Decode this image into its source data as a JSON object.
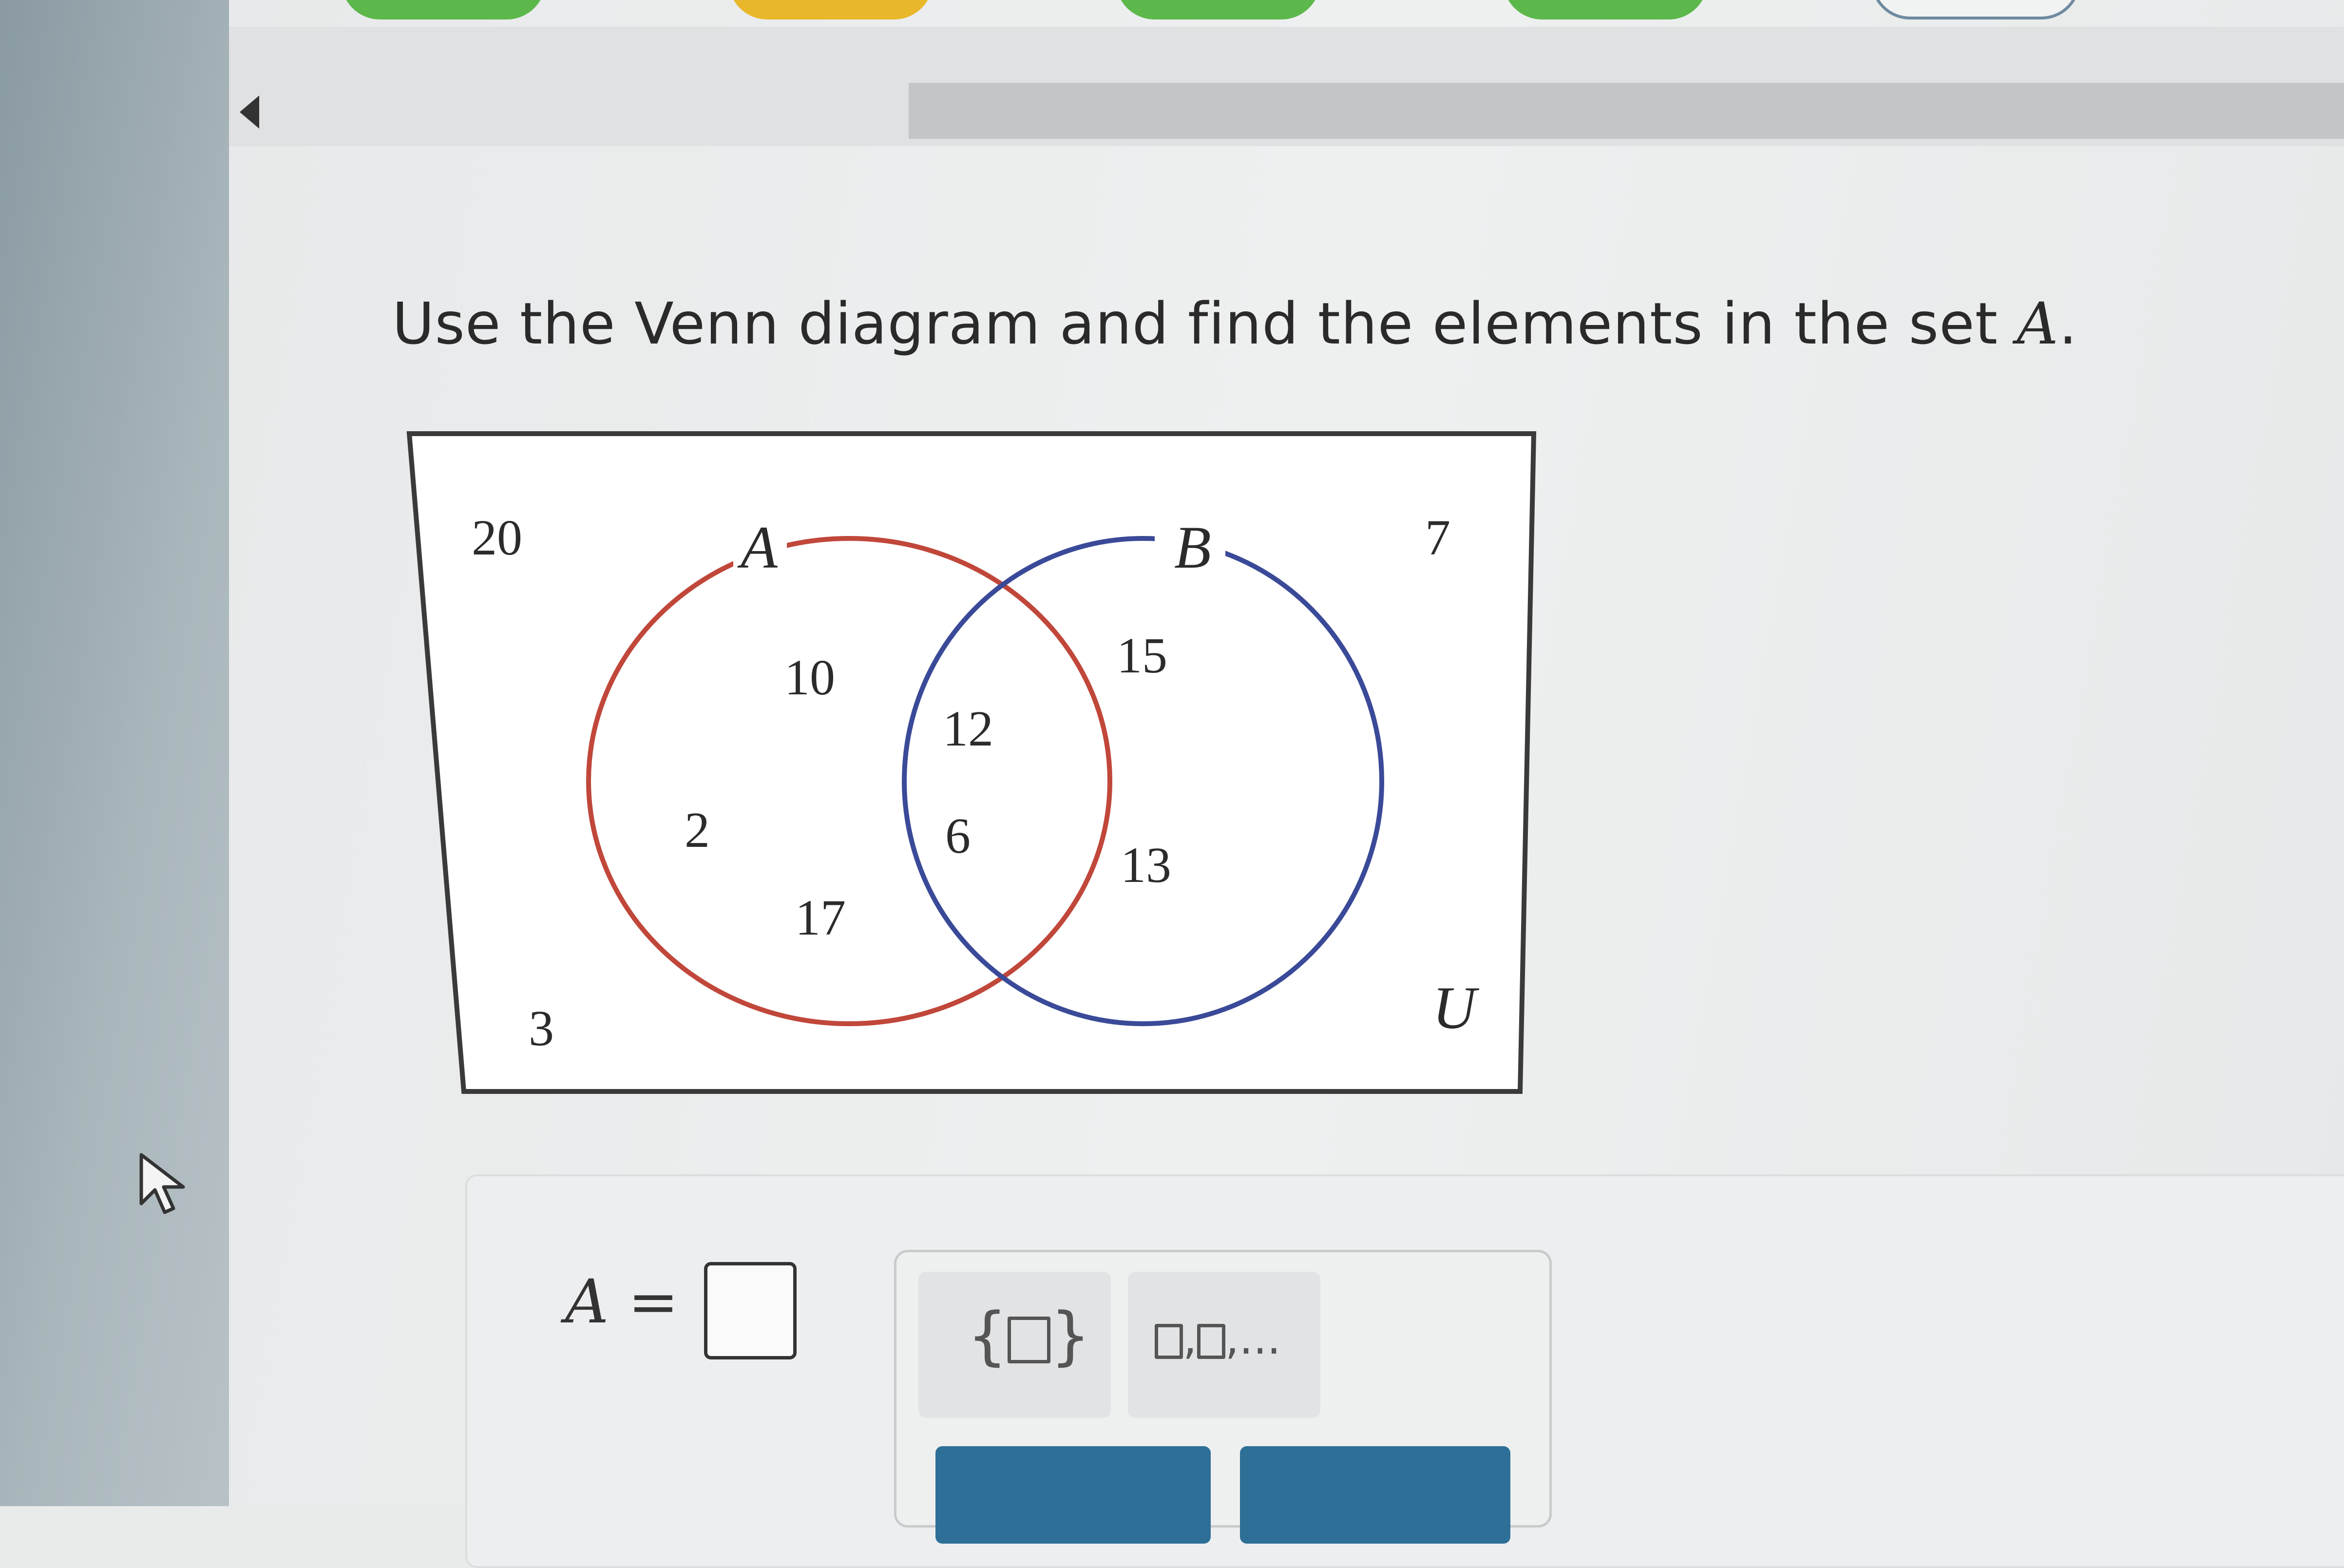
{
  "header": {
    "progress_tabs": [
      {
        "color": "#5cb84a"
      },
      {
        "color": "#e8b72a"
      },
      {
        "color": "#5cb84a"
      },
      {
        "color": "#5cb84a"
      },
      {
        "color": "#f1f2f2"
      }
    ]
  },
  "question": {
    "text": "Use the Venn diagram and find the elements in the set ",
    "variable": "A",
    "end": "."
  },
  "venn": {
    "set_a_label": "A",
    "set_b_label": "B",
    "universe_label": "U",
    "a_color": "#c0473a",
    "b_color": "#3a4a98",
    "outside": [
      "20",
      "7",
      "3"
    ],
    "a_only": [
      "10",
      "2",
      "17"
    ],
    "intersection": [
      "12",
      "6"
    ],
    "b_only": [
      "15",
      "13"
    ]
  },
  "answer": {
    "variable": "A",
    "equals": "="
  },
  "palette": {
    "set_braces_icon": "set-braces-icon",
    "list_icon": "list-icon",
    "ellipsis": ",..."
  },
  "colors": {
    "accent": "#2d6f97"
  }
}
